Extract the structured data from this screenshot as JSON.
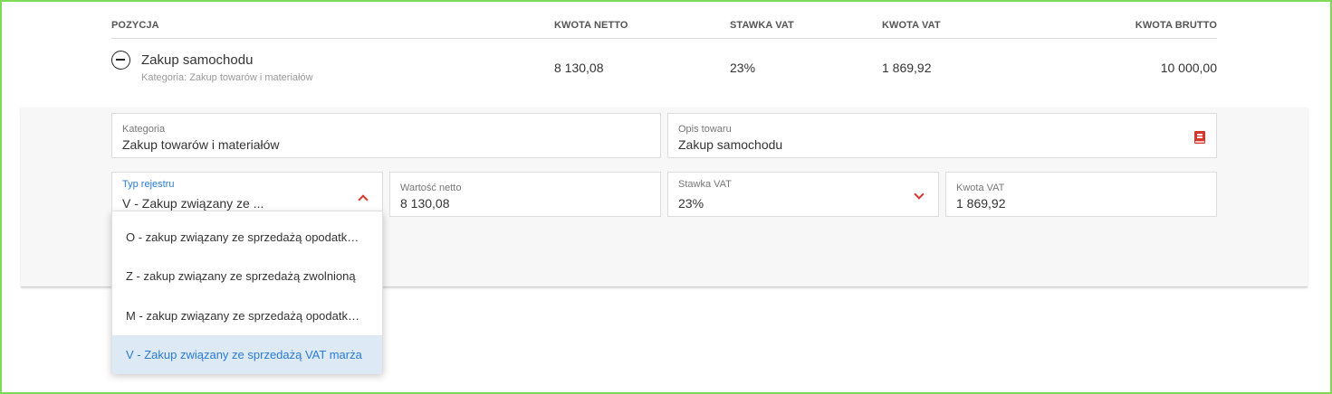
{
  "table": {
    "headers": {
      "pozycja": "POZYCJA",
      "kwota_netto": "KWOTA NETTO",
      "stawka_vat": "STAWKA VAT",
      "kwota_vat": "KWOTA VAT",
      "kwota_brutto": "KWOTA BRUTTO"
    },
    "row": {
      "name": "Zakup samochodu",
      "category": "Kategoria: Zakup towarów i materiałów",
      "kwota_netto": "8 130,08",
      "stawka_vat": "23%",
      "kwota_vat": "1 869,92",
      "kwota_brutto": "10 000,00"
    }
  },
  "form": {
    "kategoria": {
      "label": "Kategoria",
      "value": "Zakup towarów i materiałów"
    },
    "opis": {
      "label": "Opis towaru",
      "value": "Zakup samochodu",
      "icon": "book-icon"
    },
    "typ_rejestru": {
      "label": "Typ rejestru",
      "value": "V - Zakup związany ze ...",
      "expanded": true
    },
    "wartosc_netto": {
      "label": "Wartość netto",
      "value": "8 130,08"
    },
    "stawka_vat": {
      "label": "Stawka VAT",
      "value": "23%"
    },
    "kwota_vat": {
      "label": "Kwota VAT",
      "value": "1 869,92"
    }
  },
  "dropdown": {
    "options": [
      "O - zakup związany ze sprzedażą opodatkowaną",
      "Z - zakup związany ze sprzedażą zwolnioną",
      "M - zakup związany ze sprzedażą opodatkowaną i zwolnioną",
      "V - Zakup związany ze sprzedażą VAT marża"
    ],
    "selected_index": 3
  },
  "colors": {
    "accent_red": "#d9362b",
    "accent_blue": "#2a7bd6",
    "selected_bg": "#dde9f5",
    "frame": "#7ed957"
  }
}
